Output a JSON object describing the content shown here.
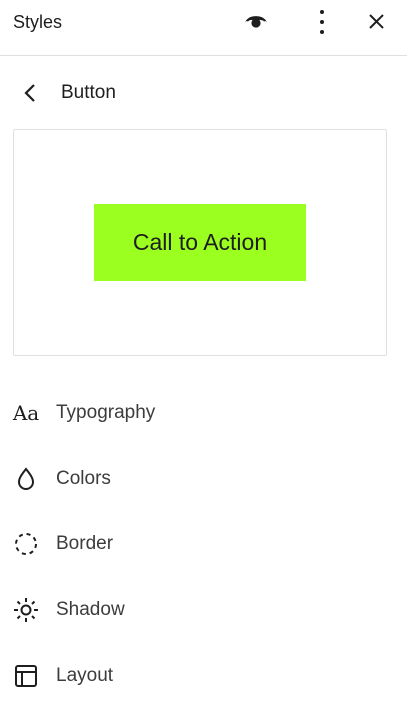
{
  "header": {
    "title": "Styles",
    "icons": [
      "eye-icon",
      "more-vertical-icon",
      "close-icon"
    ]
  },
  "nav": {
    "title": "Button",
    "back_icon": "chevron-left-icon"
  },
  "preview": {
    "button_label": "Call to Action",
    "button_color": "#9bff1f"
  },
  "menu": [
    {
      "label": "Typography",
      "icon": "typography-icon",
      "glyph": "Aa"
    },
    {
      "label": "Colors",
      "icon": "droplet-icon"
    },
    {
      "label": "Border",
      "icon": "border-icon"
    },
    {
      "label": "Shadow",
      "icon": "shadow-icon"
    },
    {
      "label": "Layout",
      "icon": "layout-icon"
    }
  ]
}
